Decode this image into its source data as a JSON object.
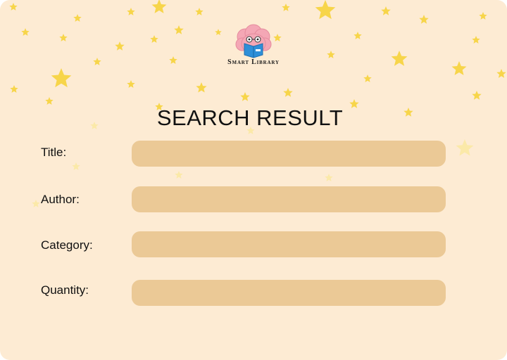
{
  "logo": {
    "text": "Smart Library",
    "icon": "brain-reading-book-icon"
  },
  "page": {
    "title": "SEARCH RESULT"
  },
  "fields": [
    {
      "label": "Title:",
      "value": ""
    },
    {
      "label": "Author:",
      "value": ""
    },
    {
      "label": "Category:",
      "value": ""
    },
    {
      "label": "Quantity:",
      "value": ""
    }
  ],
  "colors": {
    "background": "#FDEBD3",
    "field": "#EBC996",
    "star": "#F7D54A",
    "star_faded": "#FBE9A8"
  }
}
